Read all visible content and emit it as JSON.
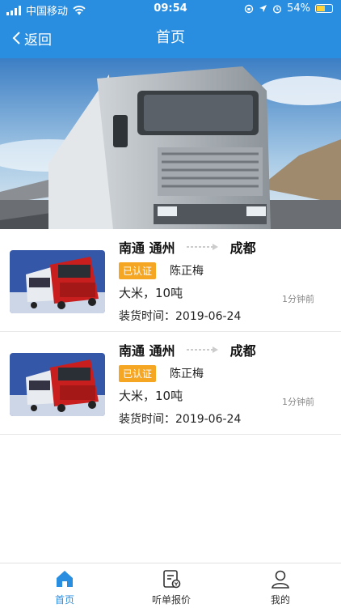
{
  "status_bar": {
    "carrier": "中国移动",
    "time": "09:54",
    "battery": "54%"
  },
  "nav": {
    "back_label": "返回",
    "title": "首页"
  },
  "orders": [
    {
      "origin": "南通 通州",
      "destination": "成都",
      "verified_label": "已认证",
      "contact": "陈正梅",
      "cargo": "大米，10吨",
      "load_date": "装货时间：2019-06-24",
      "posted": "1分钟前"
    },
    {
      "origin": "南通 通州",
      "destination": "成都",
      "verified_label": "已认证",
      "contact": "陈正梅",
      "cargo": "大米，10吨",
      "load_date": "装货时间：2019-06-24",
      "posted": "1分钟前"
    }
  ],
  "tabs": [
    {
      "label": "首页",
      "icon": "home-icon",
      "active": true
    },
    {
      "label": "听单报价",
      "icon": "quote-icon",
      "active": false
    },
    {
      "label": "我的",
      "icon": "user-icon",
      "active": false
    }
  ],
  "colors": {
    "primary": "#2a8ee0",
    "badge": "#f5a623"
  }
}
